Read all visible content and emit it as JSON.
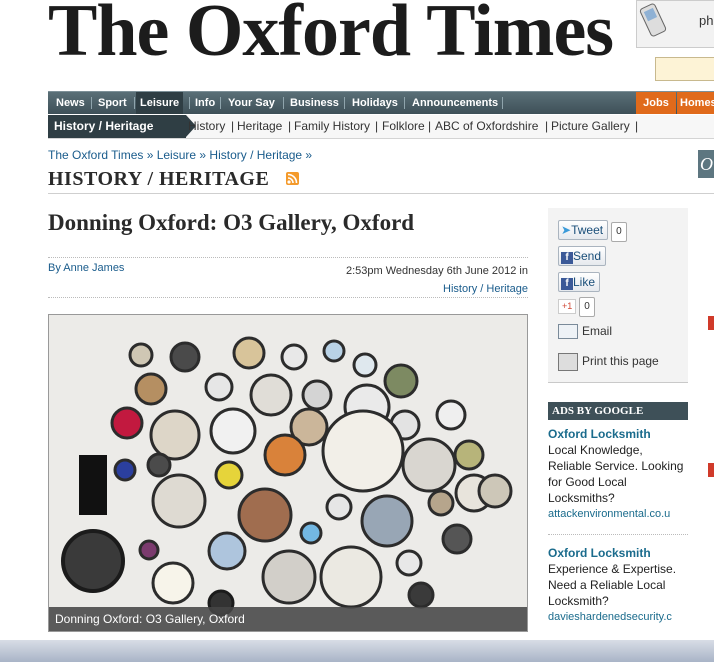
{
  "masthead": "The Oxford Times",
  "phone_ad_text": "ph",
  "main_nav": [
    "News",
    "Sport",
    "Leisure",
    "Info",
    "Your Say",
    "Business",
    "Holidays",
    "Announcements",
    "Jobs",
    "Homes"
  ],
  "sub_nav": {
    "current": "History / Heritage",
    "items": [
      "History",
      "Heritage",
      "Family History",
      "Folklore",
      "ABC of Oxfordshire",
      "Picture Gallery"
    ]
  },
  "breadcrumb": "The Oxford Times » Leisure » History / Heritage »",
  "section_title": "HISTORY / HERITAGE",
  "right_tab": "O",
  "article": {
    "headline": "Donning Oxford: O3 Gallery, Oxford",
    "byline": "By Anne James",
    "dateline": "2:53pm Wednesday 6th June 2012 in",
    "category": "History / Heritage",
    "caption": "Donning Oxford: O3 Gallery, Oxford"
  },
  "share": {
    "tweet": "Tweet",
    "tweet_count": "0",
    "send": "Send",
    "like": "Like",
    "gplus": "+1",
    "gplus_count": "0",
    "email": "Email",
    "print": "Print this page"
  },
  "ads": {
    "header": "ADS BY GOOGLE",
    "items": [
      {
        "title": "Oxford Locksmith",
        "line1": "Local Knowledge,",
        "line2": "Reliable Service. Looking",
        "line3": "for Good Local",
        "line4": "Locksmiths?",
        "url": "attackenvironmental.co.u"
      },
      {
        "title": "Oxford Locksmith",
        "line1": "Experience & Expertise.",
        "line2": "Need a Reliable Local",
        "line3": "Locksmith?",
        "url": "davieshardenedsecurity.c"
      }
    ]
  },
  "colors": {
    "nav_bg": "#4b5e66",
    "accent_orange": "#e06a1b",
    "link_blue": "#1a5c8c"
  }
}
